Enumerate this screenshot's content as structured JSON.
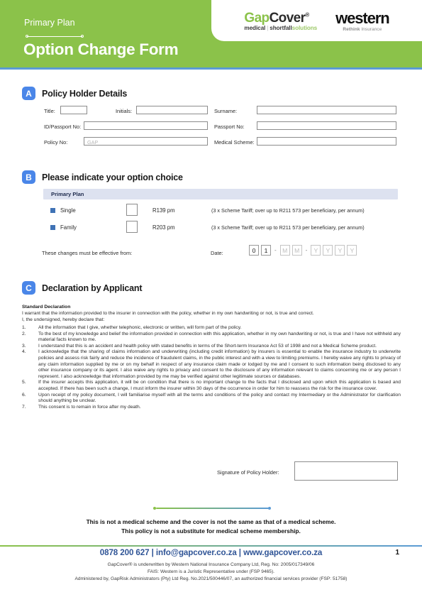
{
  "header": {
    "eyebrow": "Primary Plan",
    "title": "Option Change Form",
    "green": "#8bc24a",
    "blue_rule": "#5b9bd5",
    "logos": {
      "gapcover": {
        "word_1": "Gap",
        "word_2": "Cover",
        "registered": "®",
        "tagline_1": "medical",
        "tagline_sep": "|",
        "tagline_2": "shortfall",
        "tagline_3": "solutions",
        "green": "#8bc24a"
      },
      "western": {
        "name": "western",
        "tagline_bold": "Rethink",
        "tagline_rest": " Insurance"
      }
    }
  },
  "section_a": {
    "badge": "A",
    "title": "Policy Holder Details",
    "fields": {
      "title_label": "Title:",
      "initials_label": "Initials:",
      "surname_label": "Surname:",
      "id_passport_label": "ID/Passport No:",
      "passport_label": "Passport No:",
      "policy_label": "Policy No:",
      "policy_placeholder": "GAP",
      "medical_scheme_label": "Medical Scheme:",
      "title_value": "",
      "initials_value": "",
      "surname_value": "",
      "id_passport_value": "",
      "passport_value": "",
      "policy_value": "",
      "medical_scheme_value": ""
    }
  },
  "section_b": {
    "badge": "B",
    "title": "Please indicate your option choice",
    "plan_band": "Primary Plan",
    "options": [
      {
        "label": "Single",
        "price": "R139 pm",
        "note": "(3 x Scheme Tariff; over up to R211 573 per beneficiary, per annum)",
        "checked": false
      },
      {
        "label": "Family",
        "price": "R203 pm",
        "note": "(3 x Scheme Tariff; over up to R211 573 per beneficiary, per annum)",
        "checked": false
      }
    ],
    "effective_label": "These changes must be effective from:",
    "date_label": "Date:",
    "date_boxes": [
      {
        "value": "0",
        "placeholder": false
      },
      {
        "value": "1",
        "placeholder": false
      },
      {
        "value": "-",
        "separator": true
      },
      {
        "value": "M",
        "placeholder": true
      },
      {
        "value": "M",
        "placeholder": true
      },
      {
        "value": "-",
        "separator": true
      },
      {
        "value": "Y",
        "placeholder": true
      },
      {
        "value": "Y",
        "placeholder": true
      },
      {
        "value": "Y",
        "placeholder": true
      },
      {
        "value": "Y",
        "placeholder": true
      }
    ]
  },
  "section_c": {
    "badge": "C",
    "title": "Declaration by Applicant",
    "standard_heading": "Standard Declaration",
    "intro_1": "I warrant that the information provided to the insurer in connection with the policy, whether in my own handwriting or not, is true and correct.",
    "intro_2": "I, the undersigned, hereby declare that:",
    "items": [
      {
        "num": "1.",
        "text": "All the information that I give, whether telephonic, electronic or written, will form part of the policy."
      },
      {
        "num": "2.",
        "text": "To the best of my knowledge and belief the information provided in connection with this application, whether in my own handwriting or not, is true and I have not withheld any material facts known to me."
      },
      {
        "num": "3.",
        "text": "I understand that this is an accident and health policy with stated benefits in terms of the Short-term Insurance Act 53 of 1998 and not a Medical Scheme product."
      },
      {
        "num": "4.",
        "text": "I acknowledge that the sharing of claims information and underwriting (including credit information) by insurers is essential to enable the insurance industry to underwrite policies and assess risk fairly and reduce the incidence of fraudulent claims, in the public interest and with a view to limiting premiums. I hereby waive any rights to privacy of any claim information supplied by me or on my behalf in respect of any insurance claim made or lodged by me and I consent to such information being disclosed to any other insurance company or its agent. I also waive any rights to privacy and consent to the disclosure of any information relevant to claims concerning me or any person I represent. I also acknowledge that information provided by me may be verified against other legitimate sources or databases."
      },
      {
        "num": "5.",
        "text": "If the insurer accepts this application, it will be on condition that there is no important change to the facts that I disclosed and upon which this application is based and accepted. If there has been such a change, I must inform the insurer within 30 days of the occurrence in order for him to reassess the risk for the insurance cover."
      },
      {
        "num": "6.",
        "text": "Upon receipt of my policy document, I will familiarise myself with all the terms and conditions of the policy and contact my Intermediary or the Administrator for clarification should anything be unclear."
      },
      {
        "num": "7.",
        "text": "This consent is to remain in force after my death."
      }
    ],
    "signature_label": "Signature of Policy Holder:",
    "signature_value": ""
  },
  "disclaimer": {
    "line_1": "This is not a medical scheme and the cover is not the same as that of a medical scheme.",
    "line_2": "This policy is not a substitute for medical scheme membership."
  },
  "footer": {
    "phone": "0878 200 627",
    "sep_1": "|",
    "email": "info@gapcover.co.za",
    "sep_2": "|",
    "website": "www.gapcover.co.za",
    "legal_1": "GapCover® is underwritten by Western National Insurance Company Ltd, Reg. No: 2005/017349/06",
    "legal_2": "FAIS: Western is a Juristic Representative under (FSP 9465).",
    "legal_3": "Administered by, GapRisk Administrators (Pty) Ltd Reg. No.2021/500446/07, an authorized financial services provider (FSP: 51758)",
    "page_number": "1",
    "accent_blue": "#2f5496"
  }
}
